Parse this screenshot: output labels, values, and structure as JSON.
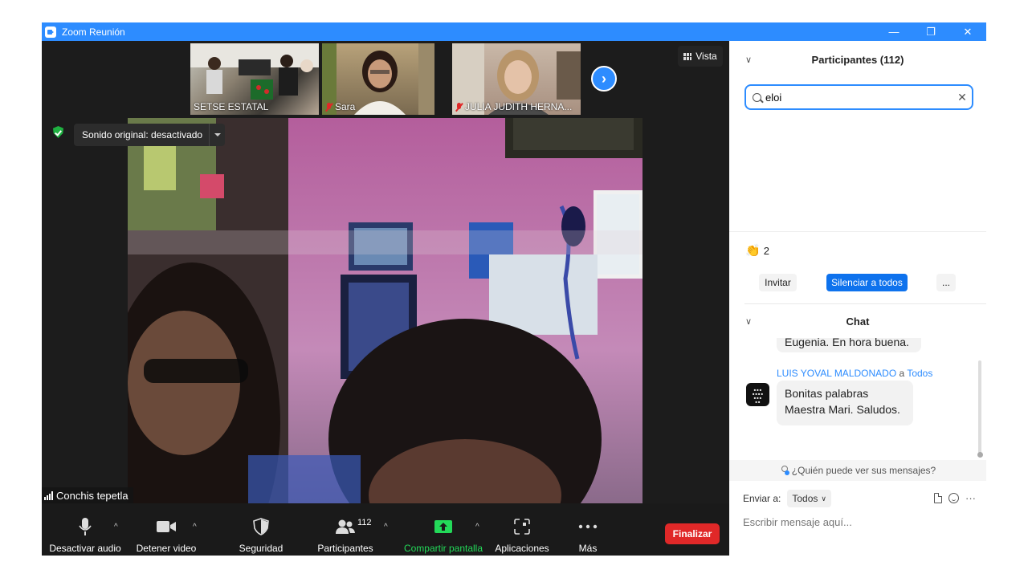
{
  "window": {
    "title": "Zoom Reunión",
    "controls": {
      "minimize": "—",
      "restore": "❐",
      "close": "✕"
    },
    "accent": "#2d8cff"
  },
  "gallery": {
    "thumbnails": [
      {
        "name": "SETSE ESTATAL",
        "muted": false
      },
      {
        "name": "Sara",
        "muted": true
      },
      {
        "name": "JULIA JUDITH HERNA...",
        "muted": true
      }
    ],
    "view_label": "Vista"
  },
  "main_video": {
    "sound_label": "Sonido original: desactivado",
    "speaker_name": "Conchis  tepetla"
  },
  "toolbar": {
    "mute_label": "Desactivar audio",
    "video_label": "Detener video",
    "security_label": "Seguridad",
    "participants_label": "Participantes",
    "participants_count": "112",
    "share_label": "Compartir pantalla",
    "apps_label": "Aplicaciones",
    "more_label": "Más",
    "end_label": "Finalizar",
    "end_color": "#e02828",
    "share_color": "#23d959"
  },
  "participants_panel": {
    "title": "Participantes (112)",
    "search_value": "eloi",
    "reaction_count": "2",
    "invite_label": "Invitar",
    "mute_all_label": "Silenciar a todos",
    "more_label": "..."
  },
  "chat_panel": {
    "title": "Chat",
    "messages": [
      {
        "text_tail": "Eugenia. En hora buena."
      },
      {
        "sender": "LUIS YOVAL MALDONADO",
        "connector": "a",
        "recipient": "Todos",
        "line1": "Bonitas palabras",
        "line2": "Maestra Mari. Saludos."
      }
    ],
    "who_sees_label": "¿Quién puede ver sus mensajes?",
    "send_to_label": "Enviar a:",
    "send_to_value": "Todos",
    "input_placeholder": "Escribir mensaje aquí..."
  }
}
